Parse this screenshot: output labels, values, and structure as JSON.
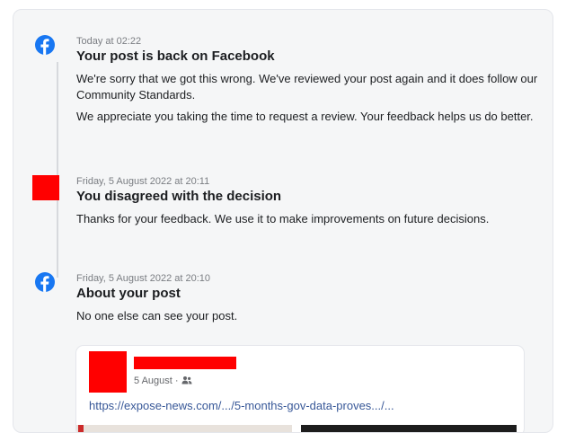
{
  "entries": [
    {
      "timestamp": "Today at 02:22",
      "title": "Your post is back on Facebook",
      "paragraphs": [
        "We're sorry that we got this wrong. We've reviewed your post again and it does follow our Community Standards.",
        "We appreciate you taking the time to request a review. Your feedback helps us do better."
      ],
      "icon": "facebook-icon"
    },
    {
      "timestamp": "Friday, 5 August 2022 at 20:11",
      "title": "You disagreed with the decision",
      "paragraphs": [
        "Thanks for your feedback. We use it to make improvements on future decisions."
      ],
      "icon": "redacted-avatar"
    },
    {
      "timestamp": "Friday, 5 August 2022 at 20:10",
      "title": "About your post",
      "paragraphs": [
        "No one else can see your post."
      ],
      "icon": "facebook-icon"
    }
  ],
  "post_preview": {
    "date": "5 August ·",
    "audience_icon": "friends-icon",
    "link": "https://expose-news.com/.../5-months-gov-data-proves.../..."
  },
  "colors": {
    "facebook_blue": "#1877f2",
    "redaction": "#ff0000",
    "link": "#385898"
  }
}
